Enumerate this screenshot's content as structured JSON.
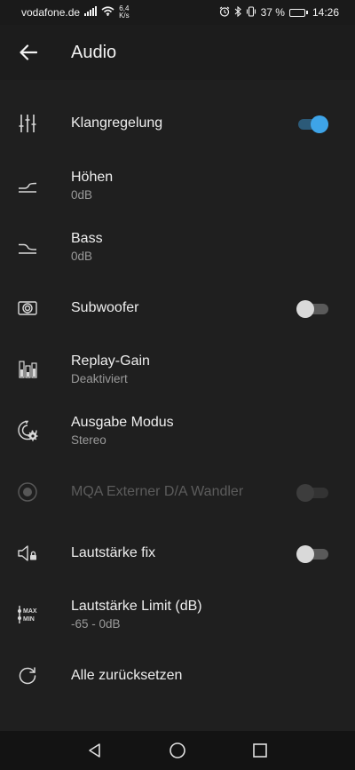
{
  "status_bar": {
    "carrier": "vodafone.de",
    "speed_value": "6,4",
    "speed_unit": "K/s",
    "battery": "37 %",
    "battery_level": 0.37,
    "time": "14:26"
  },
  "header": {
    "title": "Audio"
  },
  "settings": {
    "klangregelung": {
      "label": "Klangregelung",
      "toggle": "on"
    },
    "hoehen": {
      "label": "Höhen",
      "value": "0dB"
    },
    "bass": {
      "label": "Bass",
      "value": "0dB"
    },
    "subwoofer": {
      "label": "Subwoofer",
      "toggle": "off"
    },
    "replay_gain": {
      "label": "Replay-Gain",
      "value": "Deaktiviert"
    },
    "ausgabe_modus": {
      "label": "Ausgabe Modus",
      "value": "Stereo"
    },
    "mqa": {
      "label": "MQA Externer D/A Wandler",
      "toggle": "off",
      "enabled": false
    },
    "lautstaerke_fix": {
      "label": "Lautstärke fix",
      "toggle": "off"
    },
    "lautstaerke_limit": {
      "label": "Lautstärke Limit (dB)",
      "value": "-65 - 0dB",
      "icon_top": "MAX",
      "icon_bottom": "MIN"
    },
    "reset": {
      "label": "Alle zurücksetzen"
    }
  },
  "icons": {
    "back": "arrow-left-icon",
    "klangregelung": "equalizer-sliders-icon",
    "hoehen": "treble-curve-icon",
    "bass": "bass-curve-icon",
    "subwoofer": "speaker-icon",
    "replay_gain": "level-meter-icon",
    "ausgabe_modus": "output-mode-gear-icon",
    "mqa": "mqa-icon",
    "lautstaerke_fix": "speaker-lock-icon",
    "lautstaerke_limit": "volume-limit-icon",
    "reset": "reset-icon"
  },
  "colors": {
    "background": "#1f1f1f",
    "accent": "#3ea4e8",
    "text": "#eeeeee",
    "subtext": "#9a9a9a"
  }
}
